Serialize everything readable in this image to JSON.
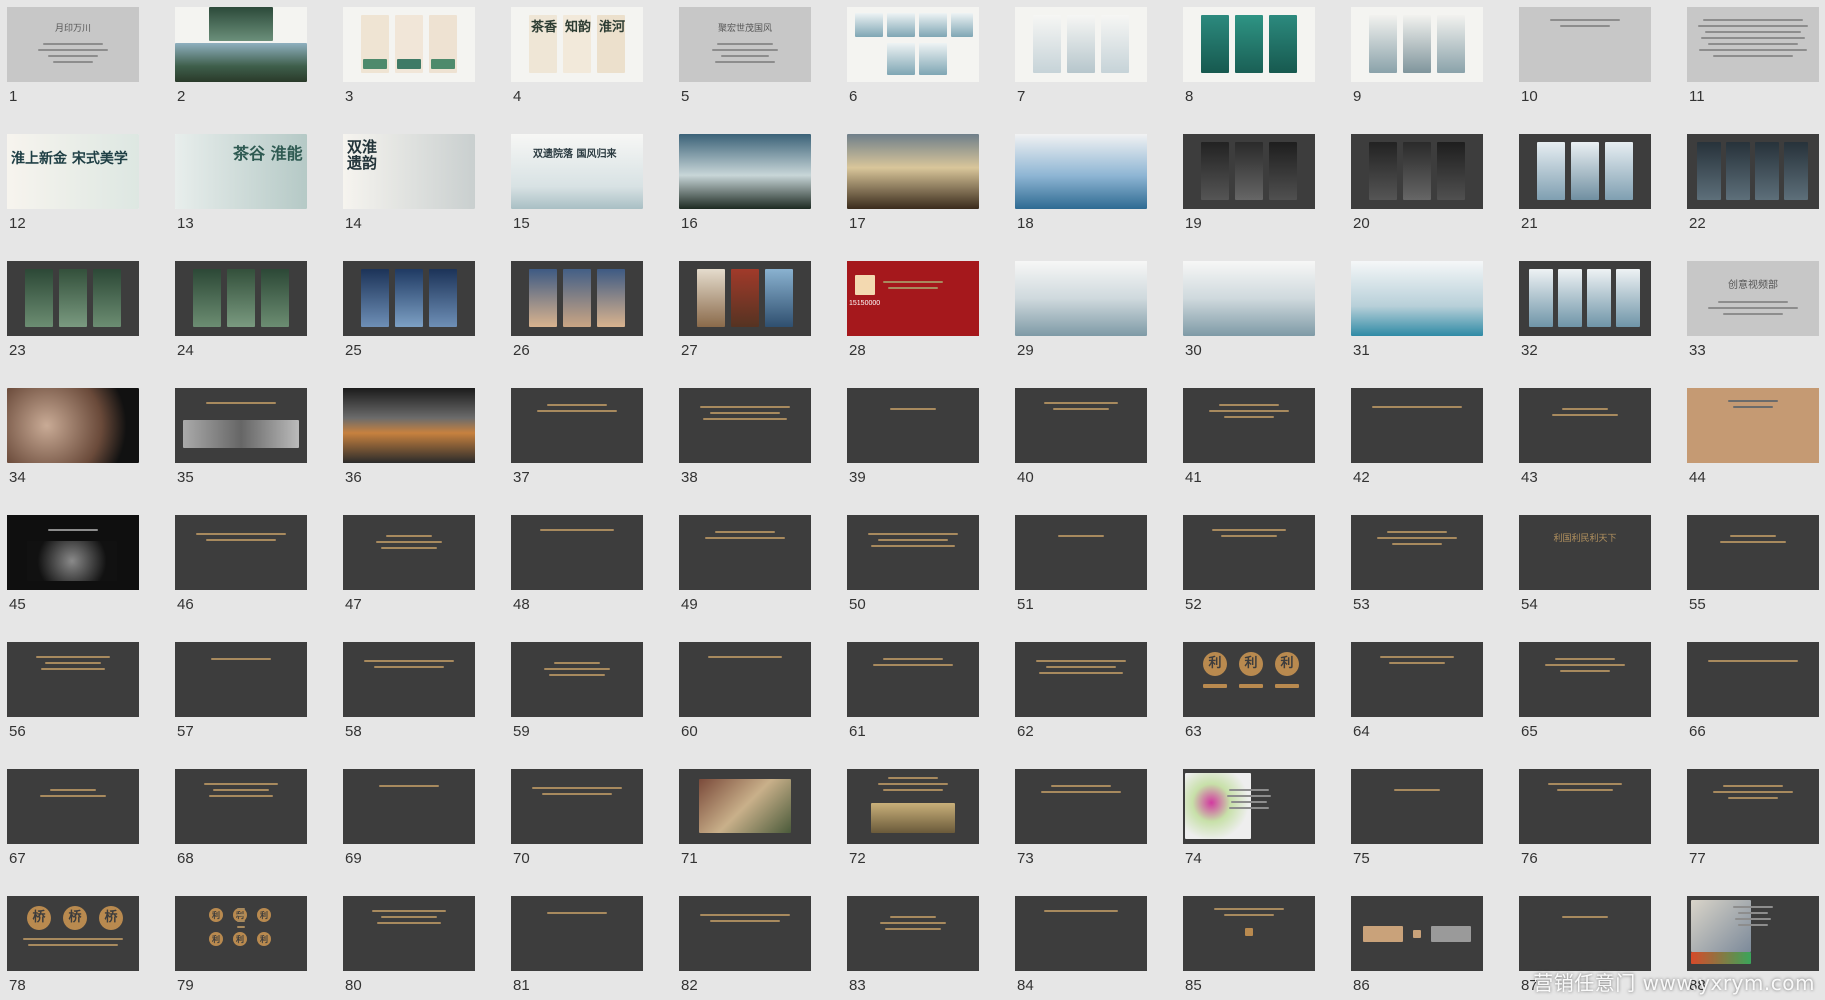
{
  "watermark": "营销任意门 www.yxrym.com",
  "slide_text": {
    "s1_title": "月印万川",
    "s5_title": "聚宏世茂国风",
    "s33_title": "创意视频部",
    "s54_title": "利国利民利天下",
    "s12_title": "淮上新金 宋式美学",
    "s13_title": "茶谷 淮能",
    "s14_title": "双淮遗韵",
    "s15_title": "双遗院落 国风归来",
    "s4_chars": [
      "茶香",
      "知韵",
      "淮河"
    ],
    "s28_number": "15150000",
    "s63_char": "利",
    "s78_char": "桥",
    "s79_char": "利"
  },
  "slides": [
    {
      "num": "1"
    },
    {
      "num": "2"
    },
    {
      "num": "3"
    },
    {
      "num": "4"
    },
    {
      "num": "5"
    },
    {
      "num": "6"
    },
    {
      "num": "7"
    },
    {
      "num": "8"
    },
    {
      "num": "9"
    },
    {
      "num": "10"
    },
    {
      "num": "11"
    },
    {
      "num": "12"
    },
    {
      "num": "13"
    },
    {
      "num": "14"
    },
    {
      "num": "15"
    },
    {
      "num": "16"
    },
    {
      "num": "17"
    },
    {
      "num": "18"
    },
    {
      "num": "19"
    },
    {
      "num": "20"
    },
    {
      "num": "21"
    },
    {
      "num": "22"
    },
    {
      "num": "23"
    },
    {
      "num": "24"
    },
    {
      "num": "25"
    },
    {
      "num": "26"
    },
    {
      "num": "27"
    },
    {
      "num": "28"
    },
    {
      "num": "29"
    },
    {
      "num": "30"
    },
    {
      "num": "31"
    },
    {
      "num": "32"
    },
    {
      "num": "33"
    },
    {
      "num": "34"
    },
    {
      "num": "35"
    },
    {
      "num": "36"
    },
    {
      "num": "37"
    },
    {
      "num": "38"
    },
    {
      "num": "39"
    },
    {
      "num": "40"
    },
    {
      "num": "41"
    },
    {
      "num": "42"
    },
    {
      "num": "43"
    },
    {
      "num": "44"
    },
    {
      "num": "45"
    },
    {
      "num": "46"
    },
    {
      "num": "47"
    },
    {
      "num": "48"
    },
    {
      "num": "49"
    },
    {
      "num": "50"
    },
    {
      "num": "51"
    },
    {
      "num": "52"
    },
    {
      "num": "53"
    },
    {
      "num": "54"
    },
    {
      "num": "55"
    },
    {
      "num": "56"
    },
    {
      "num": "57"
    },
    {
      "num": "58"
    },
    {
      "num": "59"
    },
    {
      "num": "60"
    },
    {
      "num": "61"
    },
    {
      "num": "62"
    },
    {
      "num": "63"
    },
    {
      "num": "64"
    },
    {
      "num": "65"
    },
    {
      "num": "66"
    },
    {
      "num": "67"
    },
    {
      "num": "68"
    },
    {
      "num": "69"
    },
    {
      "num": "70"
    },
    {
      "num": "71"
    },
    {
      "num": "72"
    },
    {
      "num": "73"
    },
    {
      "num": "74"
    },
    {
      "num": "75"
    },
    {
      "num": "76"
    },
    {
      "num": "77"
    },
    {
      "num": "78"
    },
    {
      "num": "79"
    },
    {
      "num": "80"
    },
    {
      "num": "81"
    },
    {
      "num": "82"
    },
    {
      "num": "83"
    },
    {
      "num": "84"
    },
    {
      "num": "85"
    },
    {
      "num": "86"
    },
    {
      "num": "87"
    },
    {
      "num": "88"
    }
  ]
}
